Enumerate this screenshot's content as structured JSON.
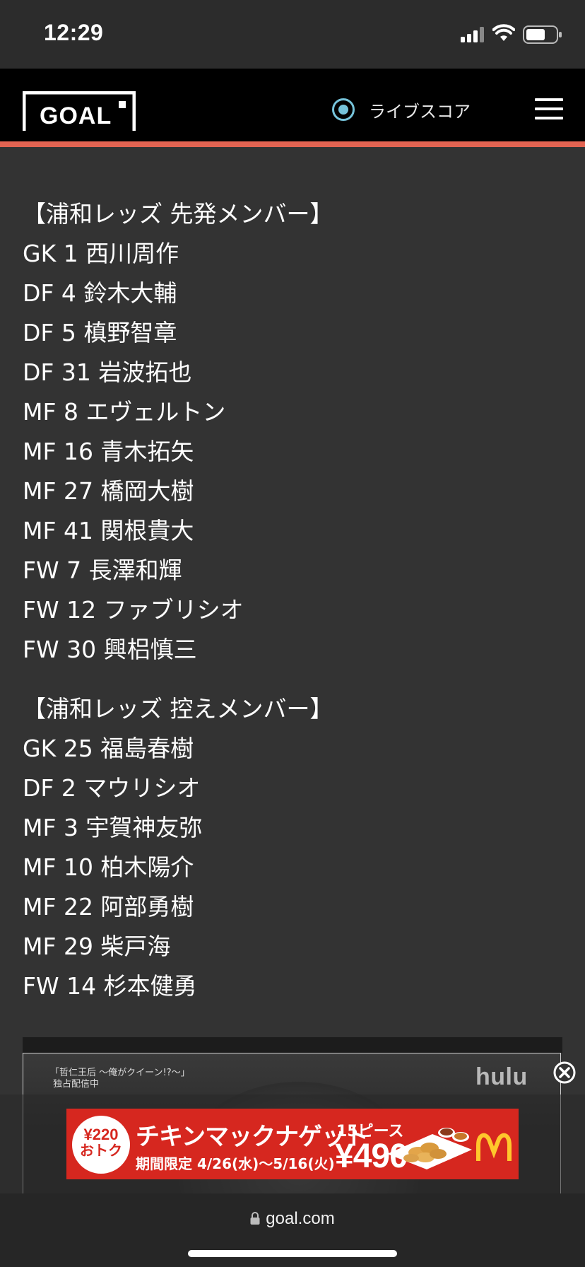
{
  "status_bar": {
    "time": "12:29"
  },
  "header": {
    "logo_text": "GOAL",
    "live_score_label": "ライブスコア",
    "accent_color": "#e36452"
  },
  "lineup": {
    "starters_heading": "【浦和レッズ 先発メンバー】",
    "starters": [
      "GK 1 西川周作",
      "DF 4 鈴木大輔",
      "DF 5 槙野智章",
      "DF 31 岩波拓也",
      "MF 8 エヴェルトン",
      "MF 16 青木拓矢",
      "MF 27 橋岡大樹",
      "MF 41 関根貴大",
      "FW 7 長澤和輝",
      "FW 12 ファブリシオ",
      "FW 30 興梠慎三"
    ],
    "subs_heading": "【浦和レッズ 控えメンバー】",
    "subs": [
      "GK 25 福島春樹",
      "DF 2 マウリシオ",
      "MF 3 宇賀神友弥",
      "MF 10 柏木陽介",
      "MF 22 阿部勇樹",
      "MF 29 柴戸海",
      "FW 14 杉本健勇"
    ]
  },
  "video_ad": {
    "caption_line1": "「哲仁王后 〜俺がクイーン!?〜」",
    "caption_line2": "独占配信中",
    "brand": "hulu"
  },
  "banner_ad": {
    "badge_price": "¥220",
    "badge_label": "おトク",
    "title": "チキンマックナゲット",
    "count": "15ピース",
    "period": "期間限定 4/26(水)〜5/16(火)",
    "price": "¥490",
    "brand_color": "#d6271f"
  },
  "browser": {
    "url": "goal.com"
  }
}
